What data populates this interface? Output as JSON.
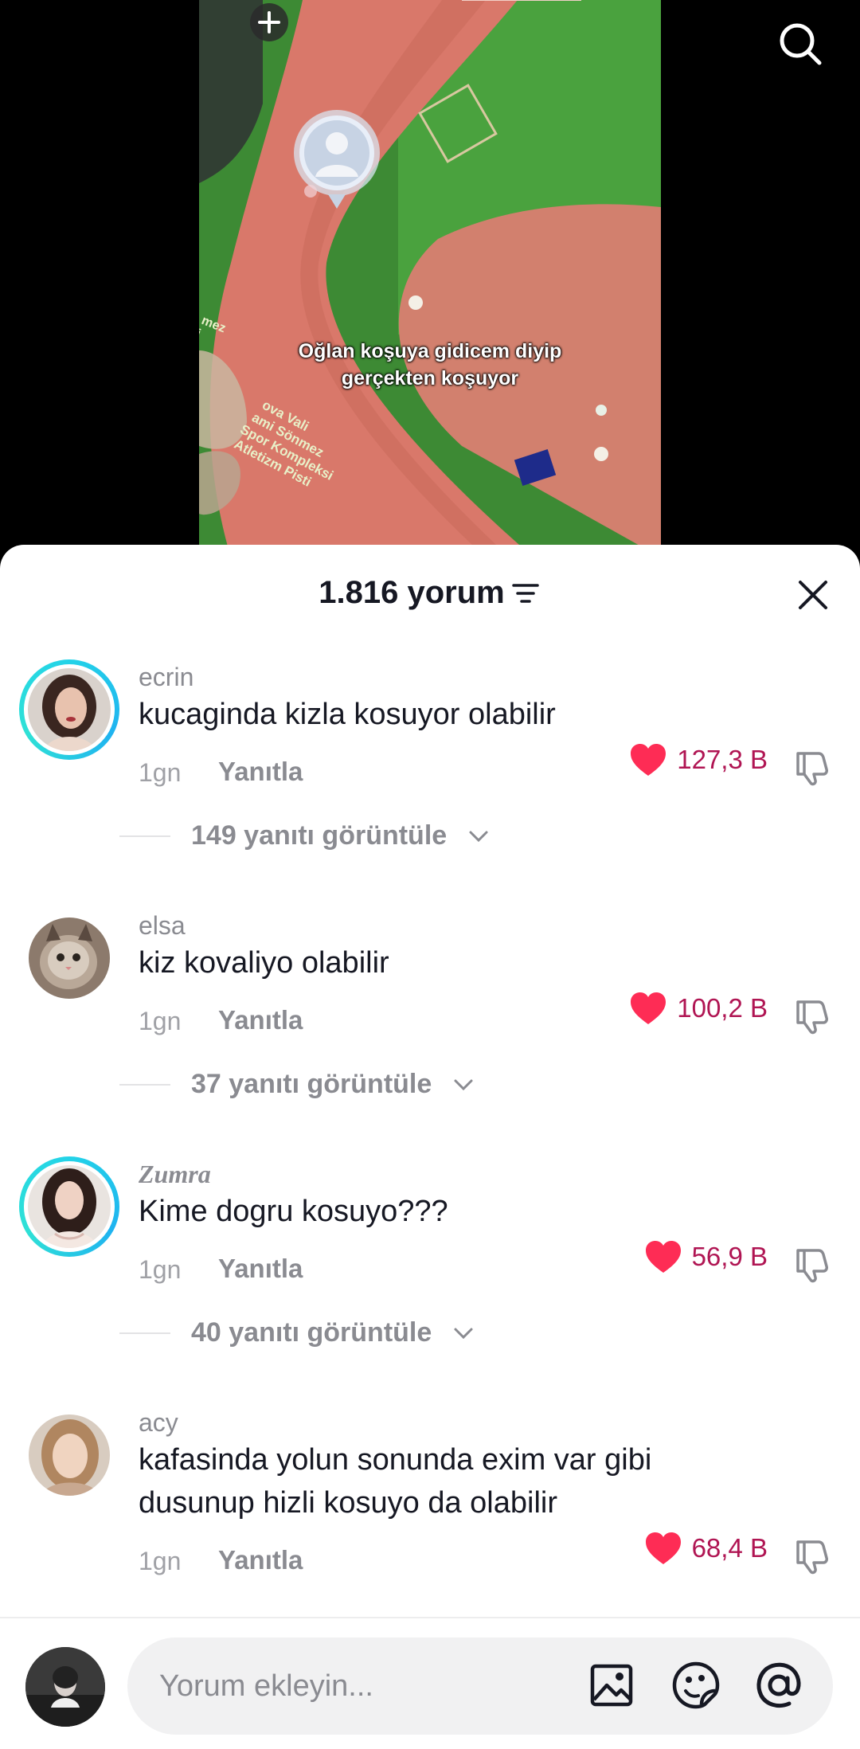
{
  "video": {
    "caption_line1": "Oğlan koşuya gidicem diyip",
    "caption_line2": "gerçekten koşuyor",
    "sign_lines": [
      "ova Vali",
      "ami Sönmez",
      "Spor Kompleksi",
      "Atletizm Pisti"
    ],
    "sign_left_lines": [
      "mez",
      "i"
    ]
  },
  "header": {
    "title": "1.816 yorum"
  },
  "comments": [
    {
      "username": "ecrin",
      "text": "kucaginda kizla kosuyor olabilir",
      "time": "1gn",
      "reply_label": "Yanıtla",
      "likes": "127,3 B",
      "view_replies": "149 yanıtı görüntüle"
    },
    {
      "username": "elsa",
      "text": "kiz kovaliyo olabilir",
      "time": "1gn",
      "reply_label": "Yanıtla",
      "likes": "100,2 B",
      "view_replies": "37 yanıtı görüntüle"
    },
    {
      "username": "Zumra",
      "text": "Kime dogru kosuyo???",
      "time": "1gn",
      "reply_label": "Yanıtla",
      "likes": "56,9 B",
      "view_replies": "40 yanıtı görüntüle"
    },
    {
      "username": "acy",
      "text": "kafasinda yolun sonunda exim var gibi dusunup hizli kosuyo da olabilir",
      "time": "1gn",
      "reply_label": "Yanıtla",
      "likes": "68,4 B"
    }
  ],
  "input": {
    "placeholder": "Yorum ekleyin..."
  },
  "colors": {
    "like_heart": "#fe2c55",
    "like_count": "#b01553",
    "ring": "#23d3e8"
  },
  "icons": [
    "search-icon",
    "plus-icon",
    "sort-icon",
    "close-icon",
    "heart-icon",
    "dislike-icon",
    "chevron-down-icon",
    "image-icon",
    "emoji-icon",
    "mention-icon"
  ]
}
